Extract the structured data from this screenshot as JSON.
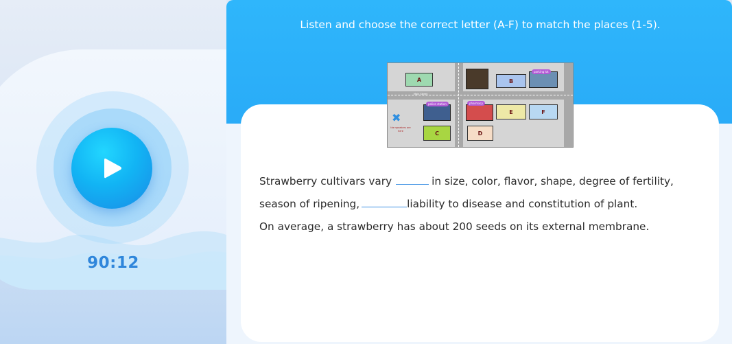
{
  "player": {
    "timer": "90:12",
    "play_icon": "play-icon"
  },
  "question": {
    "instruction": "Listen and choose the correct letter (A-F) to match the places (1-5)."
  },
  "map": {
    "letters": [
      "A",
      "B",
      "C",
      "D",
      "E",
      "F"
    ],
    "labels": {
      "parking_lot": "parking lot",
      "police_station": "police station",
      "pharmacy": "pharmacy",
      "main_street": "Main Street",
      "speakers_note": "the speakers are here"
    }
  },
  "passage": {
    "line1_before": "Strawberry cultivars vary",
    "line1_after": "in size, color, flavor, shape, degree of fertility,",
    "line2_before": "season of ripening,",
    "line2_after": "liability to disease and constitution of plant.",
    "line3": "On average, a strawberry has about 200 seeds on its external membrane."
  },
  "colors": {
    "accent": "#1f98f2",
    "timer": "#2f86db",
    "blank_underline": "#3a8fe3"
  }
}
